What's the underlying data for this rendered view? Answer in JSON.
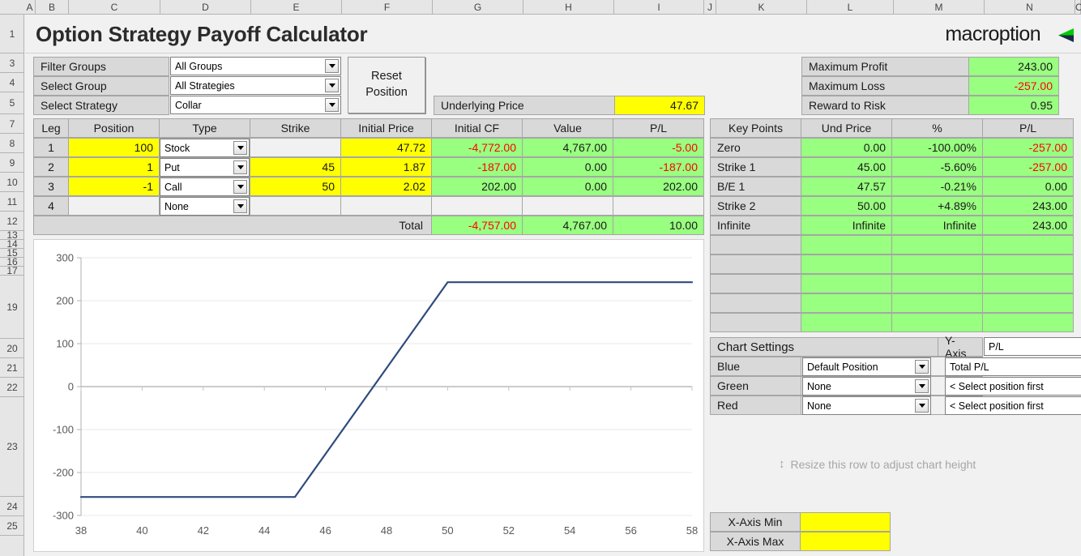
{
  "app": {
    "title": "Option Strategy Payoff Calculator",
    "brand": "macroption"
  },
  "grid": {
    "columns": [
      "A",
      "B",
      "C",
      "D",
      "E",
      "F",
      "G",
      "H",
      "I",
      "J",
      "K",
      "L",
      "M",
      "N",
      "O"
    ],
    "rows": [
      "1",
      "3",
      "4",
      "5",
      "7",
      "8",
      "9",
      "10",
      "11",
      "12",
      "13",
      "14",
      "15",
      "16",
      "17",
      "19",
      "20",
      "21",
      "22",
      "23",
      "24",
      "25"
    ]
  },
  "selectors": {
    "filter_groups_label": "Filter Groups",
    "filter_groups_value": "All Groups",
    "select_group_label": "Select Group",
    "select_group_value": "All Strategies",
    "select_strategy_label": "Select Strategy",
    "select_strategy_value": "Collar",
    "reset_button": "Reset\nPosition",
    "reset_button_line1": "Reset",
    "reset_button_line2": "Position"
  },
  "underlying": {
    "label": "Underlying Price",
    "value": "47.67"
  },
  "summary": {
    "rows": [
      {
        "label": "Maximum Profit",
        "value": "243.00",
        "negative": false
      },
      {
        "label": "Maximum Loss",
        "value": "-257.00",
        "negative": true
      },
      {
        "label": "Reward to Risk",
        "value": "0.95",
        "negative": false
      }
    ]
  },
  "legs_table": {
    "headers": [
      "Leg",
      "Position",
      "Type",
      "Strike",
      "Initial Price",
      "Initial CF",
      "Value",
      "P/L"
    ],
    "rows": [
      {
        "leg": "1",
        "position": "100",
        "type": "Stock",
        "strike": "",
        "initial_price": "47.72",
        "initial_cf": "-4,772.00",
        "cf_neg": true,
        "value": "4,767.00",
        "value_neg": false,
        "pl": "-5.00",
        "pl_neg": true,
        "has_strike": false
      },
      {
        "leg": "2",
        "position": "1",
        "type": "Put",
        "strike": "45",
        "initial_price": "1.87",
        "initial_cf": "-187.00",
        "cf_neg": true,
        "value": "0.00",
        "value_neg": false,
        "pl": "-187.00",
        "pl_neg": true,
        "has_strike": true
      },
      {
        "leg": "3",
        "position": "-1",
        "type": "Call",
        "strike": "50",
        "initial_price": "2.02",
        "initial_cf": "202.00",
        "cf_neg": false,
        "value": "0.00",
        "value_neg": false,
        "pl": "202.00",
        "pl_neg": false,
        "has_strike": true
      },
      {
        "leg": "4",
        "position": "",
        "type": "None",
        "strike": "",
        "initial_price": "",
        "initial_cf": "",
        "cf_neg": false,
        "value": "",
        "value_neg": false,
        "pl": "",
        "pl_neg": false,
        "has_strike": false
      }
    ],
    "total": {
      "label": "Total",
      "initial_cf": "-4,757.00",
      "cf_neg": true,
      "value": "4,767.00",
      "value_neg": false,
      "pl": "10.00",
      "pl_neg": false
    }
  },
  "key_points": {
    "headers": [
      "Key Points",
      "Und Price",
      "%",
      "P/L"
    ],
    "rows": [
      {
        "name": "Zero",
        "und_price": "0.00",
        "pct": "-100.00%",
        "pl": "-257.00",
        "pl_neg": true
      },
      {
        "name": "Strike 1",
        "und_price": "45.00",
        "pct": "-5.60%",
        "pl": "-257.00",
        "pl_neg": true
      },
      {
        "name": "B/E 1",
        "und_price": "47.57",
        "pct": "-0.21%",
        "pl": "0.00",
        "pl_neg": false
      },
      {
        "name": "Strike 2",
        "und_price": "50.00",
        "pct": "+4.89%",
        "pl": "243.00",
        "pl_neg": false
      },
      {
        "name": "Infinite",
        "und_price": "Infinite",
        "pct": "Infinite",
        "pl": "243.00",
        "pl_neg": false
      },
      {
        "name": "",
        "und_price": "",
        "pct": "",
        "pl": "",
        "pl_neg": false
      },
      {
        "name": "",
        "und_price": "",
        "pct": "",
        "pl": "",
        "pl_neg": false
      },
      {
        "name": "",
        "und_price": "",
        "pct": "",
        "pl": "",
        "pl_neg": false
      },
      {
        "name": "",
        "und_price": "",
        "pct": "",
        "pl": "",
        "pl_neg": false
      },
      {
        "name": "",
        "und_price": "",
        "pct": "",
        "pl": "",
        "pl_neg": false
      }
    ]
  },
  "chart_settings": {
    "title": "Chart Settings",
    "y_axis_label": "Y-Axis",
    "y_axis_value": "P/L",
    "rows": [
      {
        "color_label": "Blue",
        "position": "Default Position",
        "series": "Total P/L"
      },
      {
        "color_label": "Green",
        "position": "None",
        "series": "< Select position first"
      },
      {
        "color_label": "Red",
        "position": "None",
        "series": "< Select position first"
      }
    ]
  },
  "resize_hint": "Resize this row to adjust chart height",
  "axis_inputs": {
    "min_label": "X-Axis Min",
    "min_value": "",
    "max_label": "X-Axis Max",
    "max_value": ""
  },
  "chart_data": {
    "type": "line",
    "title": "",
    "xlabel": "",
    "ylabel": "",
    "xlim": [
      38,
      58
    ],
    "ylim": [
      -300,
      300
    ],
    "xticks": [
      38,
      40,
      42,
      44,
      46,
      48,
      50,
      52,
      54,
      56,
      58
    ],
    "yticks": [
      -300,
      -200,
      -100,
      0,
      100,
      200,
      300
    ],
    "grid": true,
    "legend": "none",
    "series": [
      {
        "name": "Total P/L",
        "color": "#2f4b7c",
        "x": [
          38,
          39,
          40,
          41,
          42,
          43,
          44,
          45,
          46,
          47,
          48,
          49,
          50,
          51,
          52,
          53,
          54,
          55,
          56,
          57,
          58
        ],
        "y": [
          -257,
          -257,
          -257,
          -257,
          -257,
          -257,
          -257,
          -257,
          -157,
          -57,
          43,
          143,
          243,
          243,
          243,
          243,
          243,
          243,
          243,
          243,
          243
        ]
      }
    ]
  },
  "colors": {
    "accent_green": "#99ff80",
    "input_yellow": "#ffff00",
    "label_gray": "#d9d9d9",
    "negative_red": "#ff0000",
    "line_blue": "#2f4b7c",
    "brand_green": "#00cc00",
    "brand_navy": "#1a2a4a"
  }
}
